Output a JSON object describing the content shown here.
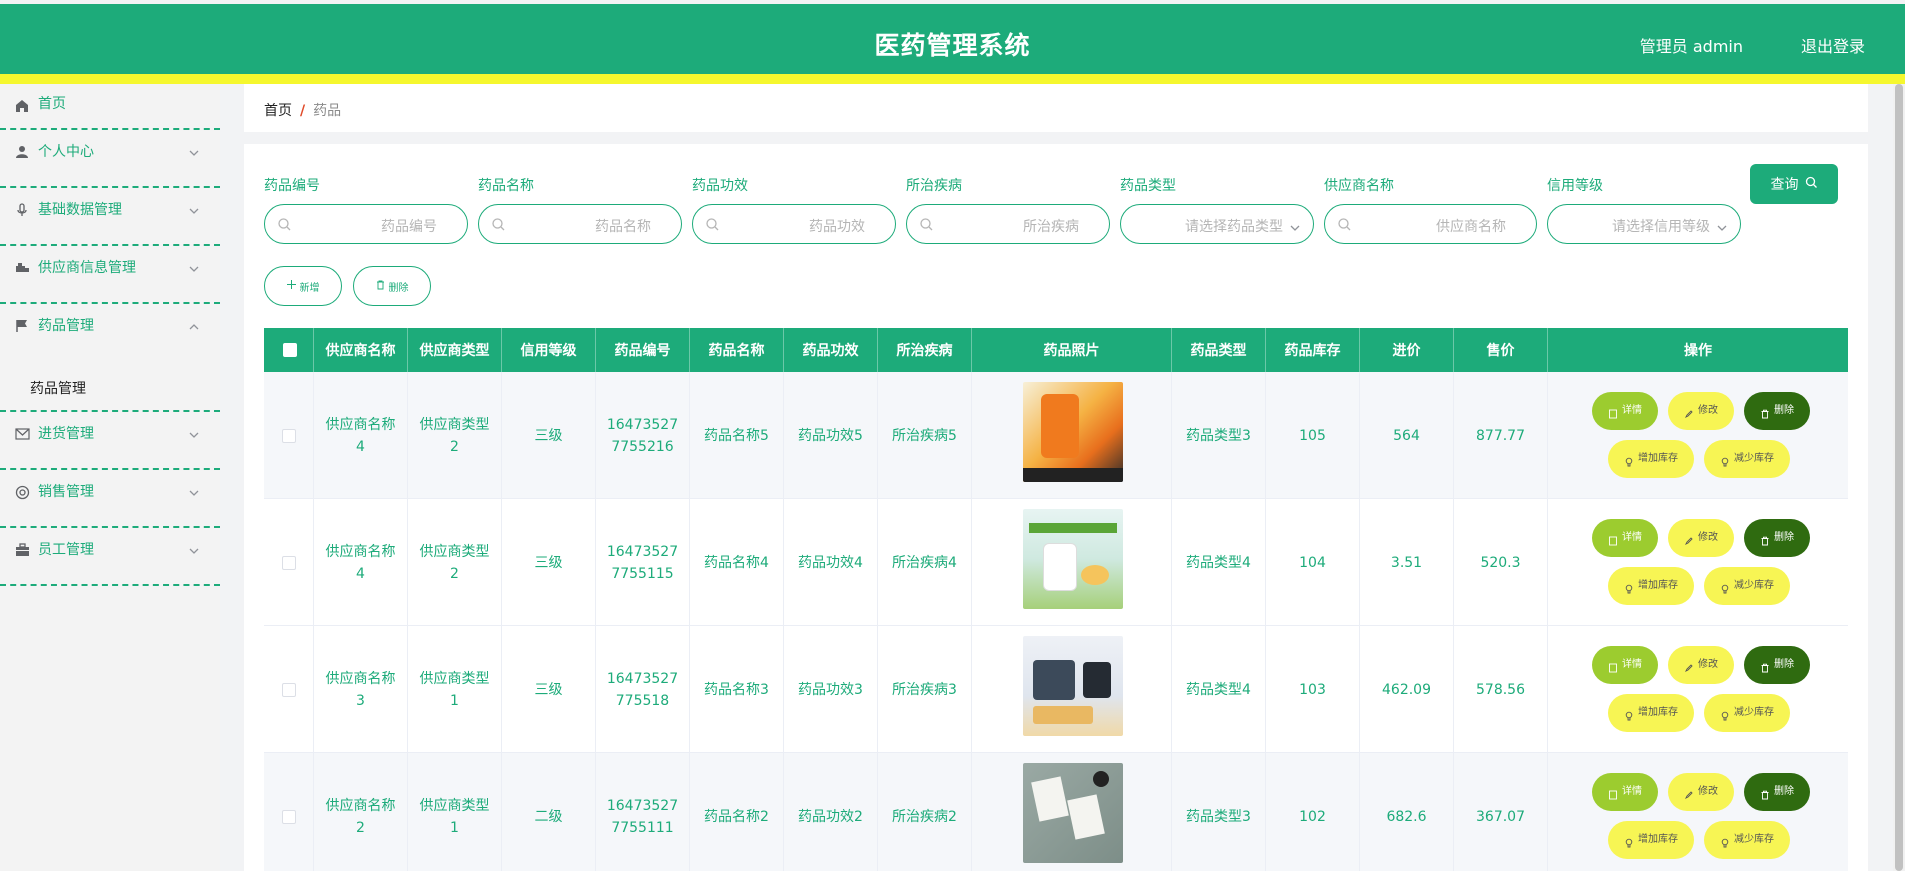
{
  "header": {
    "title": "医药管理系统",
    "user": "管理员 admin",
    "logout": "退出登录"
  },
  "sidebar": {
    "items": [
      {
        "label": "首页",
        "icon": "home-icon"
      },
      {
        "label": "个人中心",
        "icon": "user-icon"
      },
      {
        "label": "基础数据管理",
        "icon": "microphone-icon"
      },
      {
        "label": "供应商信息管理",
        "icon": "truck-icon"
      },
      {
        "label": "药品管理",
        "icon": "flag-icon"
      },
      {
        "label": "进货管理",
        "icon": "mail-icon"
      },
      {
        "label": "销售管理",
        "icon": "lifebuoy-icon"
      },
      {
        "label": "员工管理",
        "icon": "briefcase-icon"
      }
    ],
    "sub_item": "药品管理"
  },
  "breadcrumb": {
    "home": "首页",
    "separator": "/",
    "current": "药品"
  },
  "filters": [
    {
      "label": "药品编号",
      "placeholder": "药品编号"
    },
    {
      "label": "药品名称",
      "placeholder": "药品名称"
    },
    {
      "label": "药品功效",
      "placeholder": "药品功效"
    },
    {
      "label": "所治疾病",
      "placeholder": "所治疾病"
    },
    {
      "label": "药品类型",
      "placeholder": "请选择药品类型"
    },
    {
      "label": "供应商名称",
      "placeholder": "供应商名称"
    },
    {
      "label": "信用等级",
      "placeholder": "请选择信用等级"
    }
  ],
  "buttons": {
    "query": "查询",
    "add": "新增",
    "delete": "删除"
  },
  "table": {
    "headers": [
      "供应商名称",
      "供应商类型",
      "信用等级",
      "药品编号",
      "药品名称",
      "药品功效",
      "所治疾病",
      "药品照片",
      "药品类型",
      "药品库存",
      "进价",
      "售价",
      "操作"
    ],
    "rows": [
      {
        "supplier_name": [
          "供应商名称",
          "4"
        ],
        "supplier_type": [
          "供应商类型",
          "2"
        ],
        "credit": "三级",
        "code": [
          "16473527",
          "7755216"
        ],
        "name": "药品名称5",
        "effect": "药品功效5",
        "disease": "所治疾病5",
        "type": "药品类型3",
        "stock": "105",
        "cost": "564",
        "price": "877.77"
      },
      {
        "supplier_name": [
          "供应商名称",
          "4"
        ],
        "supplier_type": [
          "供应商类型",
          "2"
        ],
        "credit": "三级",
        "code": [
          "16473527",
          "7755115"
        ],
        "name": "药品名称4",
        "effect": "药品功效4",
        "disease": "所治疾病4",
        "type": "药品类型4",
        "stock": "104",
        "cost": "3.51",
        "price": "520.3"
      },
      {
        "supplier_name": [
          "供应商名称",
          "3"
        ],
        "supplier_type": [
          "供应商类型",
          "1"
        ],
        "credit": "三级",
        "code": [
          "16473527",
          "775518"
        ],
        "name": "药品名称3",
        "effect": "药品功效3",
        "disease": "所治疾病3",
        "type": "药品类型4",
        "stock": "103",
        "cost": "462.09",
        "price": "578.56"
      },
      {
        "supplier_name": [
          "供应商名称",
          "2"
        ],
        "supplier_type": [
          "供应商类型",
          "1"
        ],
        "credit": "二级",
        "code": [
          "16473527",
          "7755111"
        ],
        "name": "药品名称2",
        "effect": "药品功效2",
        "disease": "所治疾病2",
        "type": "药品类型3",
        "stock": "102",
        "cost": "682.6",
        "price": "367.07"
      }
    ],
    "actions": {
      "detail": "详情",
      "edit": "修改",
      "delete": "删除",
      "add_stock": "增加库存",
      "reduce_stock": "减少库存"
    }
  },
  "colors": {
    "primary": "#1dab7a",
    "accent_strip": "#f5f72e",
    "detail_button": "#9ccc2f",
    "edit_button": "#f7f554",
    "delete_button": "#2f6b10"
  }
}
